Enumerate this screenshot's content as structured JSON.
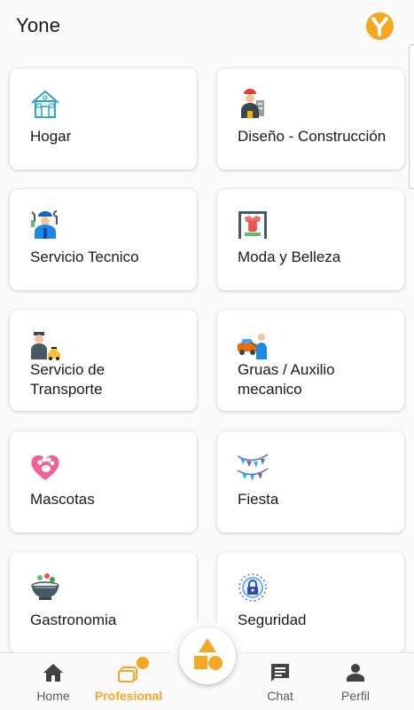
{
  "app": {
    "title": "Yone",
    "accent_color": "#f5a623",
    "logo_icon": "yone-logo-icon"
  },
  "categories": [
    {
      "label": "Hogar",
      "icon": "house-icon"
    },
    {
      "label": "Diseño - Construcción",
      "icon": "construction-worker-icon"
    },
    {
      "label": "Servicio Tecnico",
      "icon": "technician-icon"
    },
    {
      "label": "Moda y Belleza",
      "icon": "clothes-rack-icon"
    },
    {
      "label": "Servicio de Transporte",
      "label_line1": "Servicio de",
      "label_line2": "Transporte",
      "icon": "driver-taxi-icon"
    },
    {
      "label": "Gruas / Auxilio mecanico",
      "label_line1": "Gruas / Auxilio",
      "label_line2": "mecanico",
      "icon": "tow-truck-icon"
    },
    {
      "label": "Mascotas",
      "icon": "paw-heart-icon"
    },
    {
      "label": "Fiesta",
      "icon": "party-garland-icon"
    },
    {
      "label": "Gastronomia",
      "icon": "food-bowl-icon"
    },
    {
      "label": "Seguridad",
      "icon": "security-lock-icon"
    }
  ],
  "bottom_nav": {
    "items": [
      {
        "label": "Home",
        "icon": "home-icon",
        "active": false
      },
      {
        "label": "Profesional",
        "icon": "briefcase-icon",
        "active": true
      },
      {
        "label": "Chat",
        "icon": "chat-icon",
        "active": false
      },
      {
        "label": "Perfil",
        "icon": "person-icon",
        "active": false
      }
    ],
    "center_button_icon": "shapes-icon"
  }
}
